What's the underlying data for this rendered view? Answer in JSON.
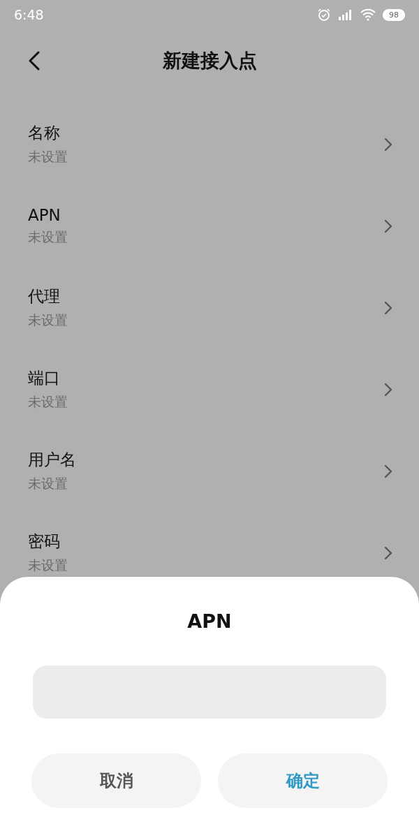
{
  "status_bar": {
    "time": "6:48",
    "battery": "98"
  },
  "header": {
    "title": "新建接入点"
  },
  "settings": [
    {
      "label": "名称",
      "value": "未设置"
    },
    {
      "label": "APN",
      "value": "未设置"
    },
    {
      "label": "代理",
      "value": "未设置"
    },
    {
      "label": "端口",
      "value": "未设置"
    },
    {
      "label": "用户名",
      "value": "未设置"
    },
    {
      "label": "密码",
      "value": "未设置"
    }
  ],
  "dialog": {
    "title": "APN",
    "buttons": [
      {
        "label": "取消",
        "kind": "cancel"
      },
      {
        "label": "确定",
        "kind": "confirm"
      }
    ]
  }
}
